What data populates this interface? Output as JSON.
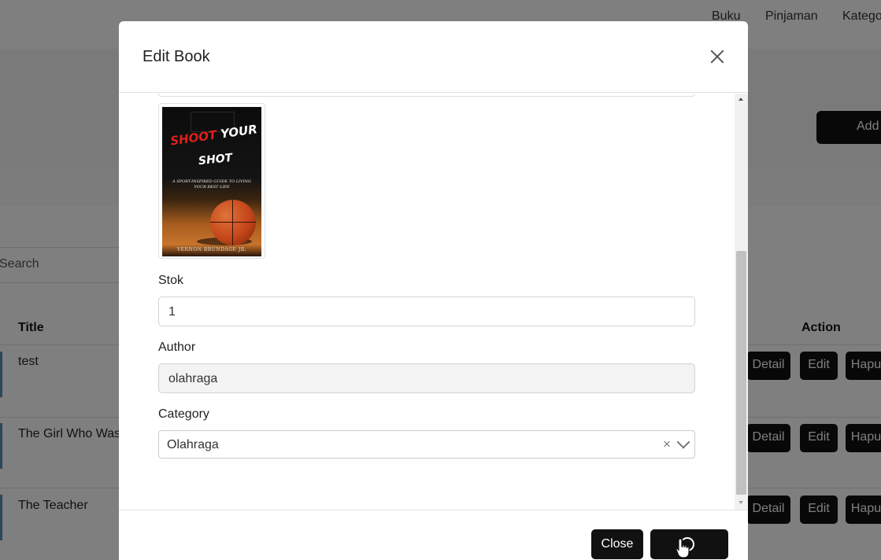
{
  "nav": {
    "items": [
      "Buku",
      "Pinjaman",
      "Kategori"
    ]
  },
  "background": {
    "add_button_label": "Add",
    "search_placeholder": "Search",
    "table": {
      "headers": {
        "title": "Title",
        "action": "Action"
      },
      "rows": [
        {
          "title": "test"
        },
        {
          "title": "The Girl Who Was"
        },
        {
          "title": "The Teacher"
        }
      ],
      "actions": {
        "detail": "Detail",
        "edit": "Edit",
        "delete": "Hapus"
      }
    }
  },
  "modal": {
    "title": "Edit Book",
    "cover": {
      "title_red": "SHOOT",
      "title_white": "YOUR",
      "title_line2": "SHOT",
      "subtitle": "A SPORT-INSPIRED GUIDE TO LIVING YOUR BEST LIFE",
      "author": "VERNON BRUNDAGE JR."
    },
    "fields": {
      "stok": {
        "label": "Stok",
        "value": "1"
      },
      "author": {
        "label": "Author",
        "value": "olahraga"
      },
      "category": {
        "label": "Category",
        "value": "Olahraga"
      }
    },
    "footer": {
      "close_label": "Close"
    }
  }
}
